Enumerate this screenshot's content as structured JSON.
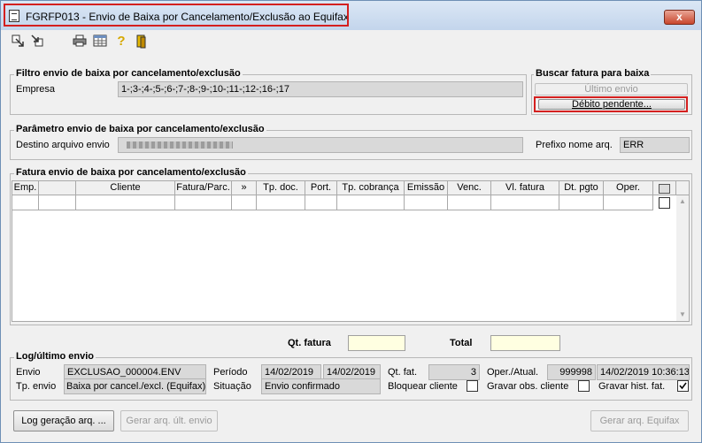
{
  "window": {
    "title": "FGRFP013 - Envio de Baixa por Cancelamento/Exclusão ao Equifax",
    "close_glyph": "x"
  },
  "toolbar": {
    "icons": [
      "export-icon",
      "import-icon",
      "print-icon",
      "spreadsheet-icon",
      "help-icon",
      "exit-icon"
    ]
  },
  "filtro": {
    "title": "Filtro envio de baixa por cancelamento/exclusão",
    "empresa_label": "Empresa",
    "empresa_value": "1-;3-;4-;5-;6-;7-;8-;9-;10-;11-;12-;16-;17"
  },
  "buscar": {
    "title": "Buscar fatura para baixa",
    "ultimo_envio": "Último envio",
    "debito_pendente": "Débito pendente..."
  },
  "parametro": {
    "title": "Parâmetro envio de baixa por cancelamento/exclusão",
    "destino_label": "Destino arquivo envio",
    "destino_value": "",
    "prefixo_label": "Prefixo nome arq.",
    "prefixo_value": "ERR"
  },
  "fatura": {
    "title": "Fatura envio de baixa por cancelamento/exclusão",
    "columns": [
      "Emp.",
      "Cliente",
      "Fatura/Parc.",
      "»",
      "Tp. doc.",
      "Port.",
      "Tp. cobrança",
      "Emissão",
      "Venc.",
      "Vl. fatura",
      "Dt. pgto",
      "Oper."
    ]
  },
  "totais": {
    "qt_fatura_label": "Qt. fatura",
    "qt_fatura_value": "",
    "total_label": "Total",
    "total_value": ""
  },
  "log": {
    "title": "Log/último envio",
    "envio_label": "Envio",
    "envio_value": "EXCLUSAO_000004.ENV",
    "periodo_label": "Período",
    "periodo_inicio": "14/02/2019",
    "periodo_fim": "14/02/2019",
    "qt_fat_label": "Qt. fat.",
    "qt_fat_value": "3",
    "oper_atual_label": "Oper./Atual.",
    "oper_value": "999998",
    "atual_value": "14/02/2019 10:36:13",
    "tp_envio_label": "Tp. envio",
    "tp_envio_value": "Baixa por cancel./excl. (Equifax)",
    "situacao_label": "Situação",
    "situacao_value": "Envio confirmado",
    "bloquear_label": "Bloquear cliente",
    "bloquear_checked": false,
    "gravar_obs_label": "Gravar obs. cliente",
    "gravar_obs_checked": false,
    "gravar_hist_label": "Gravar hist. fat.",
    "gravar_hist_checked": true
  },
  "buttons": {
    "log_geracao": "Log geração arq. ...",
    "gerar_ult": "Gerar arq. últ. envio",
    "gerar_equifax": "Gerar arq. Equifax"
  }
}
